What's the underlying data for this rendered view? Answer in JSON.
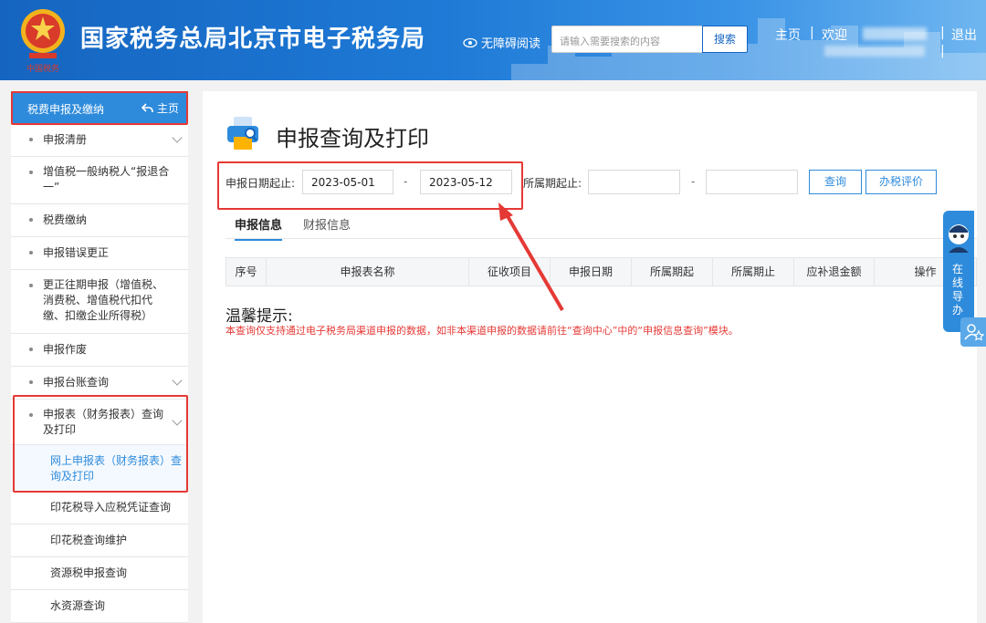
{
  "header": {
    "site_title": "国家税务总局北京市电子税务局",
    "accessibility_label": "无障碍阅读",
    "search_placeholder": "请输入需要搜索的内容",
    "search_button": "搜索",
    "nav_home": "主页",
    "nav_sep": "|",
    "nav_welcome": "欢迎",
    "nav_logout": "退出"
  },
  "sidebar": {
    "title": "税费申报及缴纳",
    "home_label": "主页",
    "items": [
      {
        "label": "申报清册"
      },
      {
        "label": "增值税一般纳税人“报退合一”"
      },
      {
        "label": "税费缴纳"
      },
      {
        "label": "申报错误更正"
      },
      {
        "label": "更正往期申报（增值税、消费税、增值税代扣代缴、扣缴企业所得税）"
      },
      {
        "label": "申报作废"
      },
      {
        "label": "申报台账查询"
      },
      {
        "label": "申报表（财务报表）查询及打印"
      }
    ],
    "sub_items": [
      {
        "label": "网上申报表（财务报表）查询及打印"
      },
      {
        "label": "印花税导入应税凭证查询"
      },
      {
        "label": "印花税查询维护"
      },
      {
        "label": "资源税申报查询"
      },
      {
        "label": "水资源查询"
      }
    ]
  },
  "main": {
    "page_title": "申报查询及打印",
    "filters": {
      "date_label": "申报日期起止:",
      "date_start": "2023-05-01",
      "date_end": "2023-05-12",
      "dash": "-",
      "period_label": "所属期起止:",
      "period_start": "",
      "period_end": ""
    },
    "buttons": {
      "query": "查询",
      "rate": "办税评价"
    },
    "tabs": [
      {
        "label": "申报信息",
        "active": true
      },
      {
        "label": "财报信息",
        "active": false
      }
    ],
    "table_headers": [
      "序号",
      "申报表名称",
      "征收项目",
      "申报日期",
      "所属期起",
      "所属期止",
      "应补退金额",
      "操作"
    ],
    "tip_title": "温馨提示:",
    "tip_text": "本查询仅支持通过电子税务局渠道申报的数据，如非本渠道申报的数据请前往“查询中心”中的“申报信息查询”模块。"
  },
  "float": {
    "guide_label": "在线导办"
  },
  "colors": {
    "primary": "#2e8bdb",
    "header_dark": "#1565c0",
    "highlight_red": "#e53935",
    "tip_red": "#e53935"
  }
}
